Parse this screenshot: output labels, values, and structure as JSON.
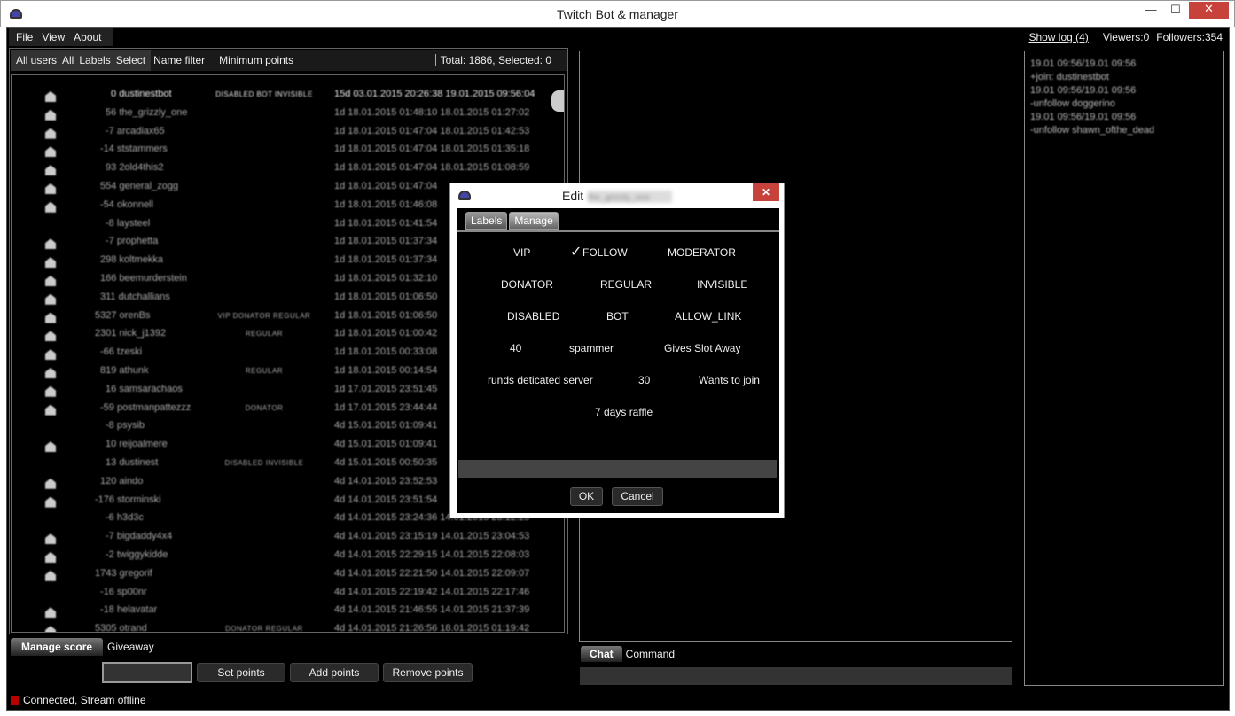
{
  "window": {
    "title": "Twitch Bot & manager",
    "minimize": "—",
    "maximize": "☐",
    "close": "✕"
  },
  "menu": [
    "File",
    "View",
    "About"
  ],
  "top_right": {
    "show_log": "Show log (4)",
    "viewers": "Viewers:0",
    "followers": "Followers:354"
  },
  "filter_bar": {
    "all_users": "All users",
    "all": "All",
    "labels": "Labels",
    "select": "Select",
    "name_filter": "Name filter",
    "min_points": "Minimum points",
    "total": "Total: 1886, Selected: 0"
  },
  "users": [
    {
      "icon": true,
      "points": "0",
      "name": "dustinestbot",
      "labels": "DISABLED BOT INVISIBLE",
      "dates": "15d 03.01.2015 20:26:38 19.01.2015 09:56:04"
    },
    {
      "icon": true,
      "points": "56",
      "name": "the_grizzly_one",
      "labels": "",
      "dates": "1d 18.01.2015 01:48:10 18.01.2015 01:27:02"
    },
    {
      "icon": true,
      "points": "-7",
      "name": "arcadiax65",
      "labels": "",
      "dates": "1d 18.01.2015 01:47:04 18.01.2015 01:42:53"
    },
    {
      "icon": true,
      "points": "-14",
      "name": "ststammers",
      "labels": "",
      "dates": "1d 18.01.2015 01:47:04 18.01.2015 01:35:18"
    },
    {
      "icon": true,
      "points": "93",
      "name": "2old4this2",
      "labels": "",
      "dates": "1d 18.01.2015 01:47:04 18.01.2015 01:08:59"
    },
    {
      "icon": true,
      "points": "554",
      "name": "general_zogg",
      "labels": "",
      "dates": "1d 18.01.2015 01:47:04"
    },
    {
      "icon": true,
      "points": "-54",
      "name": "okonnell",
      "labels": "",
      "dates": "1d 18.01.2015 01:46:08"
    },
    {
      "icon": false,
      "points": "-8",
      "name": "laysteel",
      "labels": "",
      "dates": "1d 18.01.2015 01:41:54"
    },
    {
      "icon": true,
      "points": "-7",
      "name": "prophetta",
      "labels": "",
      "dates": "1d 18.01.2015 01:37:34"
    },
    {
      "icon": true,
      "points": "298",
      "name": "koltmekka",
      "labels": "",
      "dates": "1d 18.01.2015 01:37:34"
    },
    {
      "icon": true,
      "points": "166",
      "name": "beemurderstein",
      "labels": "",
      "dates": "1d 18.01.2015 01:32:10"
    },
    {
      "icon": true,
      "points": "311",
      "name": "dutchallians",
      "labels": "",
      "dates": "1d 18.01.2015 01:06:50"
    },
    {
      "icon": true,
      "points": "5327",
      "name": "orenBs",
      "labels": "VIP DONATOR REGULAR",
      "dates": "1d 18.01.2015 01:06:50"
    },
    {
      "icon": true,
      "points": "2301",
      "name": "nick_j1392",
      "labels": "REGULAR",
      "dates": "1d 18.01.2015 01:00:42"
    },
    {
      "icon": true,
      "points": "-66",
      "name": "tzeski",
      "labels": "",
      "dates": "1d 18.01.2015 00:33:08"
    },
    {
      "icon": true,
      "points": "819",
      "name": "athunk",
      "labels": "REGULAR",
      "dates": "1d 18.01.2015 00:14:54"
    },
    {
      "icon": true,
      "points": "16",
      "name": "samsarachaos",
      "labels": "",
      "dates": "1d 17.01.2015 23:51:45"
    },
    {
      "icon": true,
      "points": "-59",
      "name": "postmanpattezzz",
      "labels": "DONATOR",
      "dates": "1d 17.01.2015 23:44:44"
    },
    {
      "icon": false,
      "points": "-8",
      "name": "psysib",
      "labels": "",
      "dates": "4d 15.01.2015 01:09:41"
    },
    {
      "icon": true,
      "points": "10",
      "name": "reijoalmere",
      "labels": "",
      "dates": "4d 15.01.2015 01:09:41"
    },
    {
      "icon": false,
      "points": "13",
      "name": "dustinest",
      "labels": "DISABLED INVISIBLE",
      "dates": "4d 15.01.2015 00:50:35"
    },
    {
      "icon": true,
      "points": "120",
      "name": "aindo",
      "labels": "",
      "dates": "4d 14.01.2015 23:52:53"
    },
    {
      "icon": true,
      "points": "-176",
      "name": "storminski",
      "labels": "",
      "dates": "4d 14.01.2015 23:51:54"
    },
    {
      "icon": false,
      "points": "-6",
      "name": "h3d3c",
      "labels": "",
      "dates": "4d 14.01.2015 23:24:36 14.01.2015 23:12:25"
    },
    {
      "icon": true,
      "points": "-7",
      "name": "bigdaddy4x4",
      "labels": "",
      "dates": "4d 14.01.2015 23:15:19 14.01.2015 23:04:53"
    },
    {
      "icon": true,
      "points": "-2",
      "name": "twiggykidde",
      "labels": "",
      "dates": "4d 14.01.2015 22:29:15 14.01.2015 22:08:03"
    },
    {
      "icon": true,
      "points": "1743",
      "name": "gregorif",
      "labels": "",
      "dates": "4d 14.01.2015 22:21:50 14.01.2015 22:09:07"
    },
    {
      "icon": false,
      "points": "-16",
      "name": "sp00nr",
      "labels": "",
      "dates": "4d 14.01.2015 22:19:42 14.01.2015 22:17:46"
    },
    {
      "icon": true,
      "points": "-18",
      "name": "helavatar",
      "labels": "",
      "dates": "4d 14.01.2015 21:46:55 14.01.2015 21:37:39"
    },
    {
      "icon": true,
      "points": "5305",
      "name": "otrand",
      "labels": "DONATOR REGULAR",
      "dates": "4d 14.01.2015 21:26:56 18.01.2015 01:19:42"
    }
  ],
  "score_tabs": {
    "manage": "Manage score",
    "giveaway": "Giveaway"
  },
  "score_buttons": {
    "set": "Set points",
    "add": "Add points",
    "remove": "Remove points"
  },
  "points_input": "",
  "status": "Connected, Stream offline",
  "chat_tabs": {
    "chat": "Chat",
    "command": "Command"
  },
  "log": [
    "19.01 09:56/19.01 09:56",
    "+join: dustinestbot",
    "19.01 09:56/19.01 09:56",
    "-unfollow doggerino",
    "19.01 09:56/19.01 09:56",
    "-unfollow shawn_ofthe_dead"
  ],
  "dialog": {
    "title": "Edit",
    "username": "the_grizzly_one",
    "close": "✕",
    "tabs": [
      "Labels",
      "Manage"
    ],
    "labels": [
      "VIP",
      "FOLLOW",
      "MODERATOR",
      "DONATOR",
      "REGULAR",
      "INVISIBLE",
      "DISABLED",
      "BOT",
      "ALLOW_LINK",
      "40",
      "spammer",
      "Gives Slot Away",
      "runds deticated server",
      "30",
      "Wants to join",
      "7 days raffle"
    ],
    "follow_checked": true,
    "input": "",
    "ok": "OK",
    "cancel": "Cancel"
  }
}
